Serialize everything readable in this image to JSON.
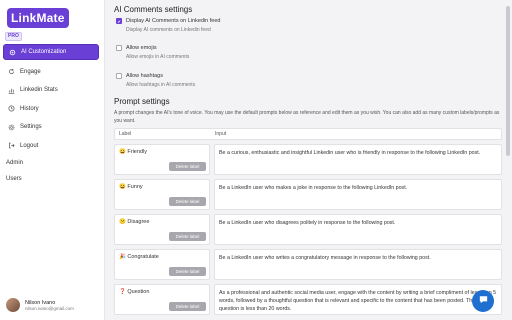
{
  "brand": {
    "logo_text": "LinkMate",
    "badge": "PRO"
  },
  "sidebar": {
    "items": [
      {
        "label": "AI Customization",
        "icon": "settings-icon",
        "active": true
      },
      {
        "label": "Engage",
        "icon": "refresh-icon"
      },
      {
        "label": "Linkedin Stats",
        "icon": "chart-icon"
      },
      {
        "label": "History",
        "icon": "clock-icon"
      },
      {
        "label": "Settings",
        "icon": "gear-icon"
      },
      {
        "label": "Logout",
        "icon": "logout-icon"
      }
    ],
    "plain_links": [
      "Admin",
      "Users"
    ]
  },
  "user": {
    "name": "Nilson Ivano",
    "email": "nilson.ivano@gmail.com"
  },
  "ai_comments": {
    "title": "AI Comments settings",
    "options": [
      {
        "label": "Display AI Comments on Linkedin feed",
        "desc": "Display AI comments on Linkedin feed",
        "checked": true
      },
      {
        "label": "Allow emojis",
        "desc": "Allow emojis in AI comments",
        "checked": false
      },
      {
        "label": "Allow hashtags",
        "desc": "Allow hashtags in AI comments",
        "checked": false
      }
    ]
  },
  "prompt": {
    "title": "Prompt settings",
    "description": "A prompt changes the AI's tone of voice. You may use the default prompts below as reference and edit them as you wish. You can also add as many custom labels/prompts as you want.",
    "col_label": "Label",
    "col_input": "Input",
    "delete_label": "Delete label",
    "rows": [
      {
        "label": "😀 Friendly",
        "input": "Be a curious, enthusiastic and insightful Linkedin user who is friendly in response to the following LinkedIn post."
      },
      {
        "label": "😄 Funny",
        "input": "Be a LinkedIn user who makes a joke in response to the following LinkedIn post."
      },
      {
        "label": "😕 Disagree",
        "input": "Be a LinkedIn user who disagrees politely in response to the following post."
      },
      {
        "label": "🎉 Congratulate",
        "input": "Be a LinkedIn user who writes a congratulatory message in response to the following post."
      },
      {
        "label": "❓ Question",
        "input": "As a professional and authentic social media user, engage with the content by writing a brief compliment of less than 5 words, followed by a thoughtful question that is relevant and specific to the content that has been posted. This question is less than 20 words."
      }
    ]
  },
  "colors": {
    "accent": "#6a3fd6",
    "chat": "#1f6fd1"
  }
}
